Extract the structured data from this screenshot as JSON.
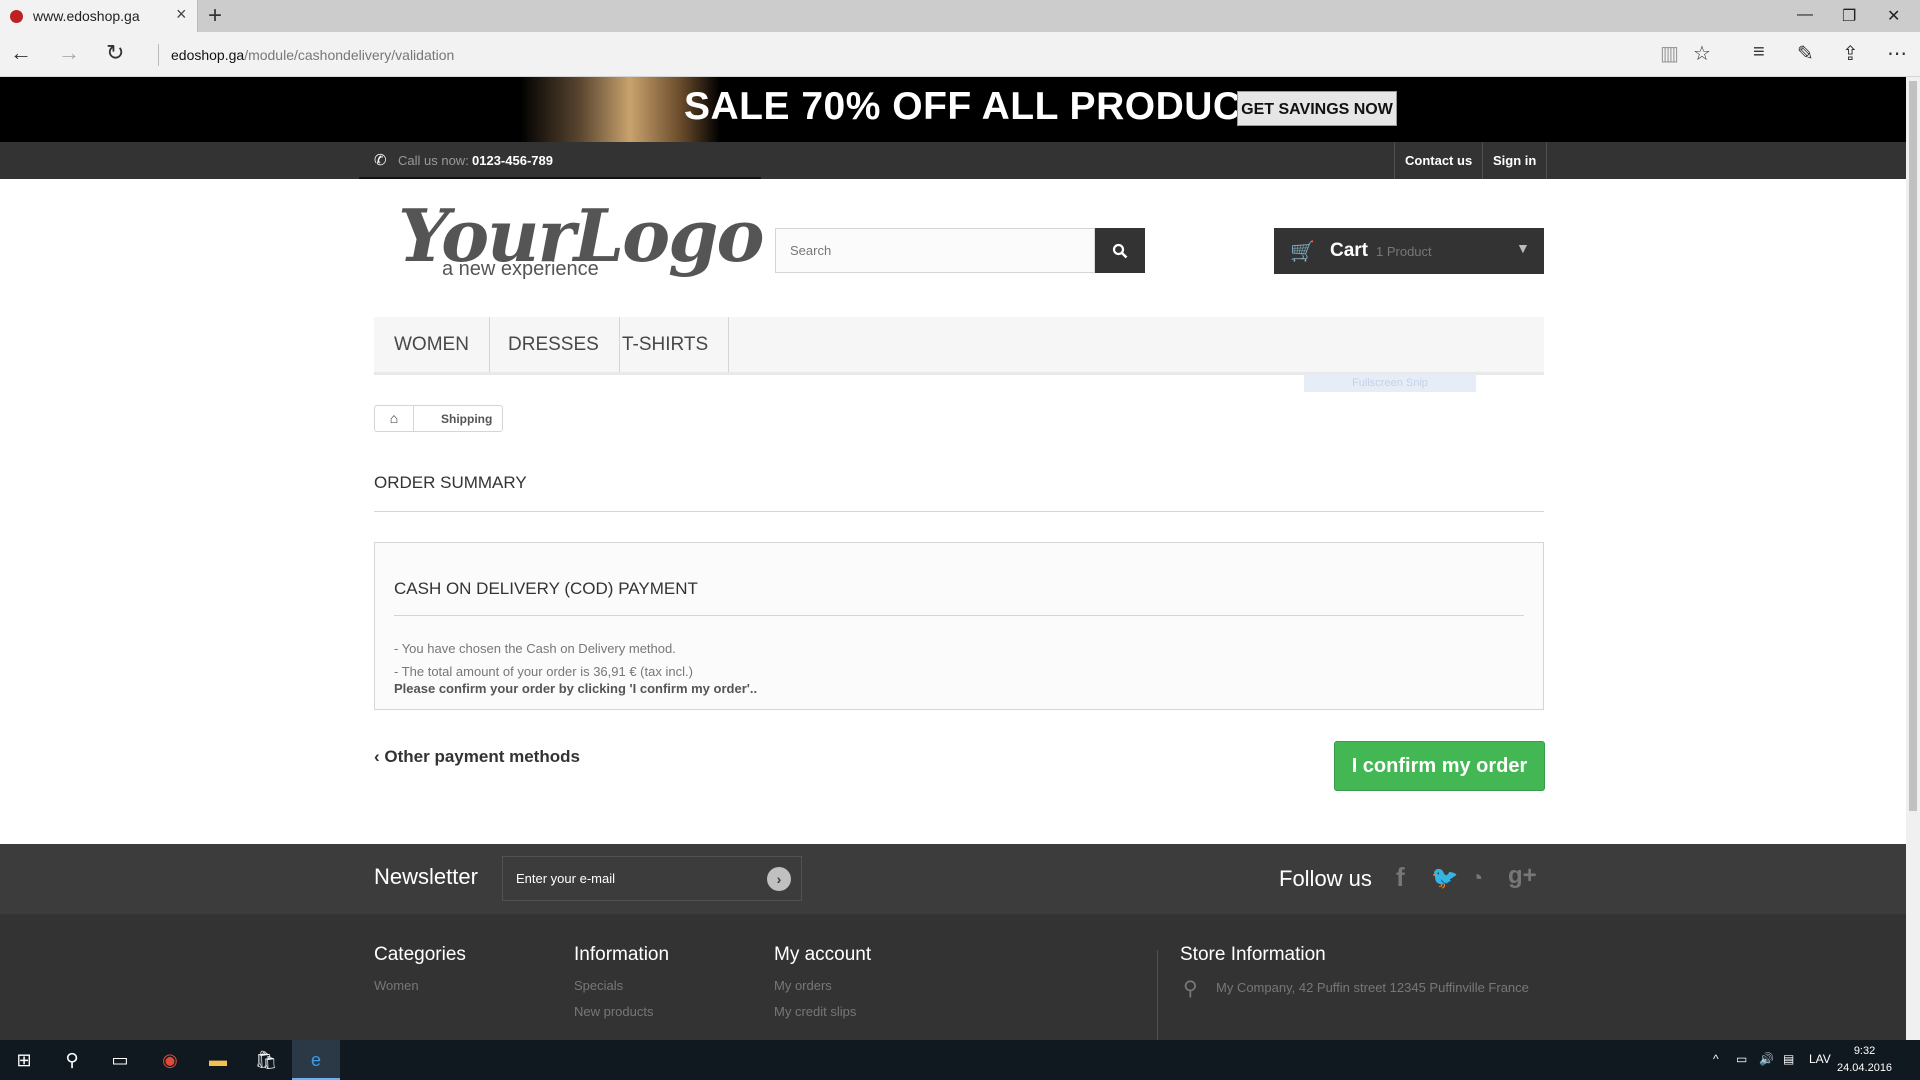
{
  "browser": {
    "tab_title": "www.edoshop.ga",
    "url_domain": "edoshop.ga",
    "url_path": "/module/cashondelivery/validation"
  },
  "banner": {
    "text": "SALE 70% OFF ALL PRODUCTS",
    "button": "GET SAVINGS NOW"
  },
  "topbar": {
    "call_label": "Call us now: ",
    "phone": "0123-456-789",
    "contact": "Contact us",
    "signin": "Sign in"
  },
  "logo": {
    "big": "YourLogo",
    "small": "a new experience"
  },
  "search": {
    "placeholder": "Search"
  },
  "cart": {
    "label": "Cart",
    "count": "1 Product"
  },
  "menu": {
    "items": [
      "WOMEN",
      "DRESSES",
      "T-SHIRTS"
    ]
  },
  "snip_label": "Fullscreen Snip",
  "breadcrumb": {
    "current": "Shipping"
  },
  "order": {
    "title": "ORDER SUMMARY",
    "box_title": "CASH ON DELIVERY (COD) PAYMENT",
    "line1": "- You have chosen the Cash on Delivery method.",
    "line2": "- The total amount of your order is 36,91 € (tax incl.)",
    "line3": "Please confirm your order by clicking 'I confirm my order'..",
    "other_methods": "Other payment methods",
    "confirm": "I confirm my order"
  },
  "newsletter": {
    "title": "Newsletter",
    "placeholder": "Enter your e-mail"
  },
  "follow": {
    "title": "Follow us"
  },
  "footer": {
    "categories": {
      "title": "Categories",
      "links": [
        "Women"
      ]
    },
    "information": {
      "title": "Information",
      "links": [
        "Specials",
        "New products"
      ]
    },
    "account": {
      "title": "My account",
      "links": [
        "My orders",
        "My credit slips"
      ]
    },
    "store": {
      "title": "Store Information",
      "address": "My Company, 42 Puffin street 12345 Puffinville France"
    }
  },
  "taskbar": {
    "lang": "LAV",
    "time": "9:32",
    "date": "24.04.2016"
  },
  "colors": {
    "confirm_green": "#43b754",
    "dark": "#333333"
  }
}
